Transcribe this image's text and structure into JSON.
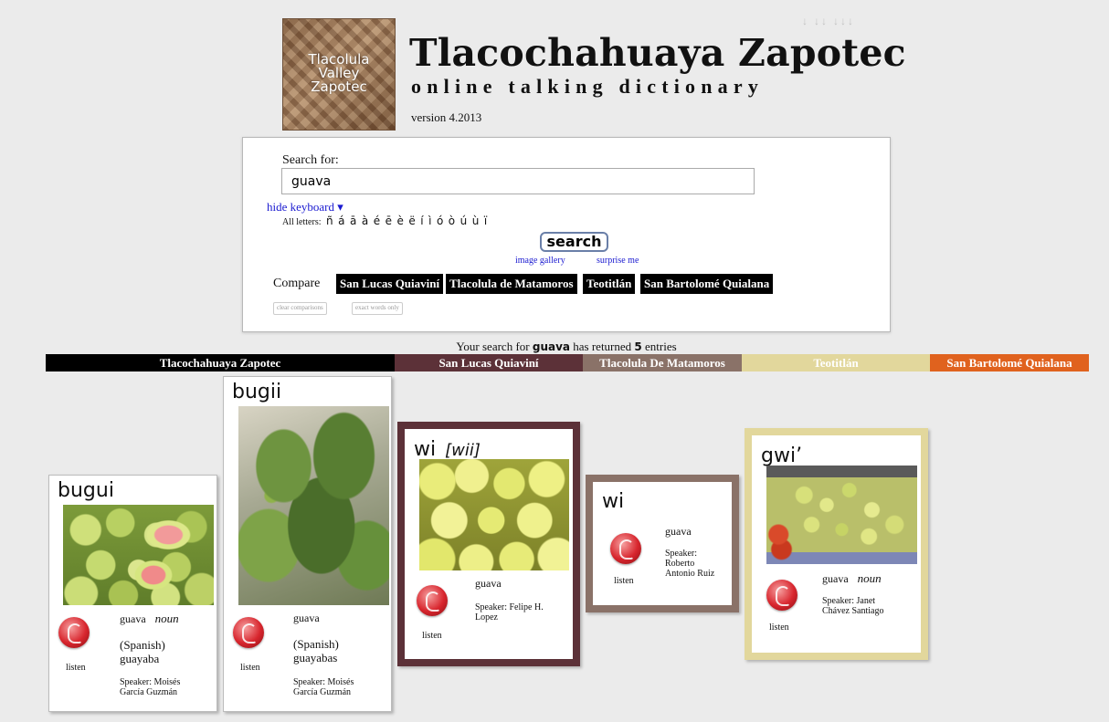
{
  "header": {
    "logo_lines": [
      "Tlacolula",
      "Valley",
      "Zapotec"
    ],
    "title": "Tlacochahuaya Zapotec",
    "subtitle": "online talking dictionary",
    "version": "version 4.2013",
    "sort_arrows": "↓ ↓↓ ↓↓↓"
  },
  "search": {
    "label": "Search for:",
    "value": "guava",
    "hide_keyboard": "hide keyboard ▾",
    "all_letters_label": "All letters:",
    "letters": [
      "ñ",
      "á",
      "ā",
      "à",
      "é",
      "ē",
      "è",
      "ë",
      "í",
      "ì",
      "ó",
      "ò",
      "ú",
      "ù",
      "ï"
    ],
    "button": "search",
    "image_gallery": "image gallery",
    "surprise_me": "surprise me",
    "compare_label": "Compare",
    "compare_options": [
      "San Lucas Quiaviní",
      "Tlacolula de Matamoros",
      "Teotitlán",
      "San Bartolomé Quialana"
    ],
    "clear_comparisons": "clear comparisons",
    "exact_words_only": "exact words only"
  },
  "results": {
    "prefix": "Your search for",
    "term": "guava",
    "middle": "has returned",
    "count": "5",
    "suffix": "entries"
  },
  "bands": [
    {
      "label": "Tlacochahuaya Zapotec",
      "color": "#000000"
    },
    {
      "label": "San Lucas Quiaviní",
      "color": "#5c3138"
    },
    {
      "label": "Tlacolula De Matamoros",
      "color": "#8a7268"
    },
    {
      "label": "Teotitlán",
      "color": "#e2d79c"
    },
    {
      "label": "San Bartolomé Quialana",
      "color": "#e0621e"
    }
  ],
  "cards": [
    {
      "word": "bugui",
      "gloss": "guava",
      "pos": "noun",
      "spanish_label": "(Spanish)",
      "spanish": "guayaba",
      "listen": "listen",
      "speaker_line1": "Speaker: Moisés",
      "speaker_line2": "García Guzmán"
    },
    {
      "word": "bugii",
      "gloss": "guava",
      "pos": "",
      "spanish_label": "(Spanish)",
      "spanish": "guayabas",
      "listen": "listen",
      "speaker_line1": "Speaker: Moisés",
      "speaker_line2": "García Guzmán"
    },
    {
      "word": "wi",
      "pronunciation": "[wii]",
      "gloss": "guava",
      "listen": "listen",
      "speaker_line1": "Speaker: Felipe H.",
      "speaker_line2": "Lopez"
    },
    {
      "word": "wi",
      "gloss": "guava",
      "listen": "listen",
      "speaker_line1": "Speaker:",
      "speaker_line2": "Roberto",
      "speaker_line3": "Antonio Ruiz"
    },
    {
      "word": "gwi’",
      "gloss": "guava",
      "pos": "noun",
      "listen": "listen",
      "speaker_line1": "Speaker: Janet",
      "speaker_line2": "Chávez Santiago"
    }
  ]
}
